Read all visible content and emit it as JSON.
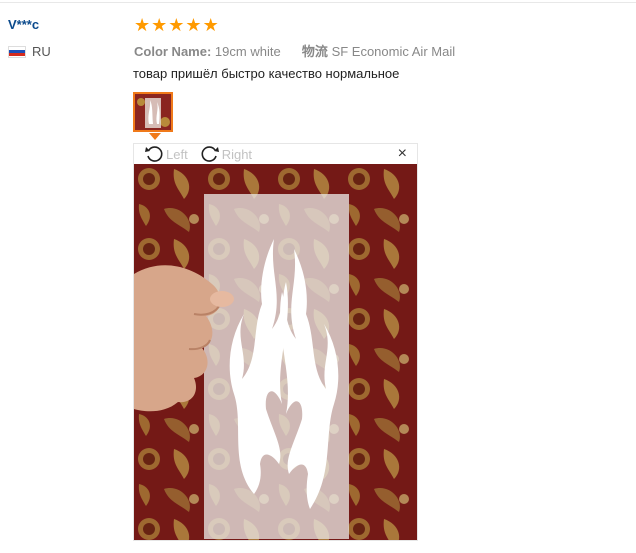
{
  "reviewer": {
    "name": "V***c",
    "country_code": "RU"
  },
  "rating": {
    "stars": 5,
    "max": 5
  },
  "attributes": {
    "color_label": "Color Name:",
    "color_value": "19cm white",
    "logistics_label": "物流",
    "logistics_value": "SF Economic Air Mail"
  },
  "review": {
    "text": "товар пришёл быстро качество нормальное"
  },
  "viewer": {
    "rotate_left": "Left",
    "rotate_right": "Right",
    "close": "×"
  },
  "colors": {
    "accent": "#f07a1a",
    "star": "#ff9a00",
    "name": "#0b4a8c"
  }
}
